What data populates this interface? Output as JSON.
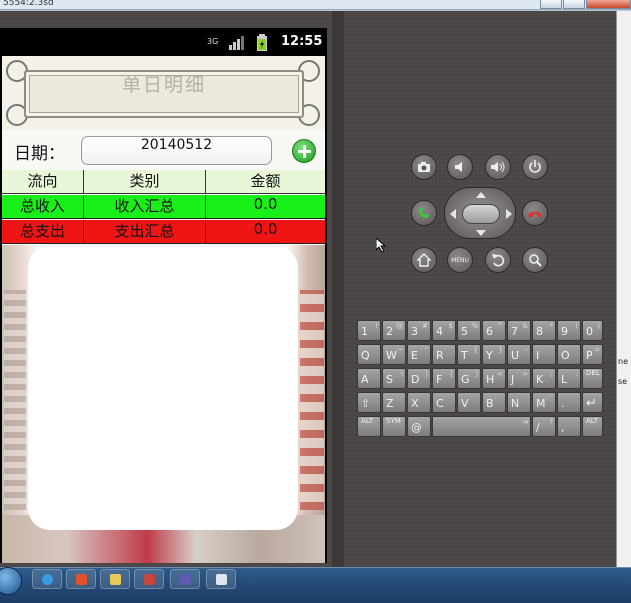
{
  "window": {
    "title": "5554:2.3sd"
  },
  "status_bar": {
    "network": "3G",
    "time": "12:55"
  },
  "app": {
    "title": "单日明细",
    "date_label": "日期：",
    "date_value": "20140512",
    "add_button": "add-icon"
  },
  "table": {
    "headers": [
      "流向",
      "类别",
      "金额"
    ],
    "rows": [
      {
        "direction": "总收入",
        "category": "收入汇总",
        "amount": "0.0",
        "color": "#19f019"
      },
      {
        "direction": "总支出",
        "category": "支出汇总",
        "amount": "0.0",
        "color": "#f01515"
      }
    ]
  },
  "hardware_buttons": {
    "camera": "camera-icon",
    "volume_down": "volume-down-icon",
    "volume_up": "volume-up-icon",
    "power": "power-icon",
    "call": "call-icon",
    "end_call": "end-call-icon",
    "home": "home-icon",
    "menu": "MENU",
    "back": "back-icon",
    "search": "search-icon"
  },
  "keyboard": {
    "row1": [
      "1",
      "2",
      "3",
      "4",
      "5",
      "6",
      "7",
      "8",
      "9",
      "0"
    ],
    "row1_alt": [
      "!",
      "@",
      "#",
      "$",
      "%",
      "^",
      "&",
      "*",
      "(",
      ")"
    ],
    "row2": [
      "Q",
      "W",
      "E",
      "R",
      "T",
      "Y",
      "U",
      "I",
      "O",
      "P"
    ],
    "row2_alt": [
      "",
      "~",
      "\"",
      "",
      "{",
      "}",
      "-",
      "",
      "",
      "="
    ],
    "row3": [
      "A",
      "S",
      "D",
      "F",
      "G",
      "H",
      "J",
      "K",
      "L",
      "DEL"
    ],
    "row3_alt": [
      "",
      "\\",
      "|",
      "[",
      "]",
      "<",
      ">",
      ";",
      ":",
      ""
    ],
    "row4": [
      "⇧",
      "Z",
      "X",
      "C",
      "V",
      "B",
      "N",
      "M",
      ".",
      "↵"
    ],
    "row5": [
      "ALT",
      "SYM",
      "@",
      "",
      "/",
      ",",
      "ALT"
    ],
    "row5_alt": [
      "",
      "",
      "",
      "⇥",
      "?",
      "",
      ""
    ]
  },
  "right_strip": {
    "labels": [
      "ne",
      "se"
    ]
  },
  "colors": {
    "income": "#19f019",
    "expense": "#f01515",
    "header_bg": "#e8f7d8",
    "accent_add": "#1d9a1d"
  }
}
